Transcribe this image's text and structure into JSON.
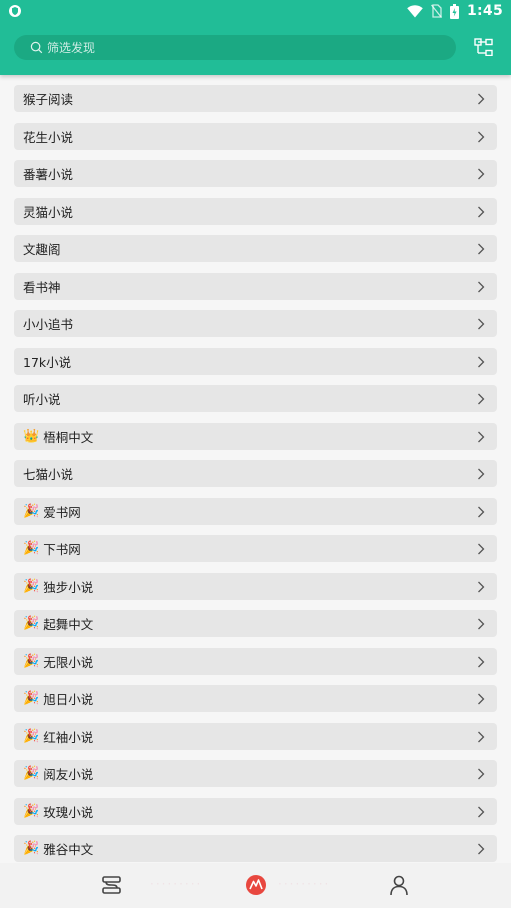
{
  "status_bar": {
    "time": "1:45",
    "icons": [
      "shield-icon",
      "wifi-icon",
      "no-sim-icon",
      "battery-icon"
    ]
  },
  "header": {
    "background_color": "#21bd97",
    "search_placeholder": "筛选发现",
    "search_icon": "search-icon",
    "menu_icon": "tree-menu-icon"
  },
  "sources": [
    {
      "label": "猴子阅读",
      "icon": ""
    },
    {
      "label": "花生小说",
      "icon": ""
    },
    {
      "label": "番薯小说",
      "icon": ""
    },
    {
      "label": "灵猫小说",
      "icon": ""
    },
    {
      "label": "文趣阁",
      "icon": ""
    },
    {
      "label": "看书神",
      "icon": ""
    },
    {
      "label": "小小追书",
      "icon": ""
    },
    {
      "label": "17k小说",
      "icon": ""
    },
    {
      "label": "听小说",
      "icon": ""
    },
    {
      "label": "梧桐中文",
      "icon": "👑"
    },
    {
      "label": "七猫小说",
      "icon": ""
    },
    {
      "label": "爱书网",
      "icon": "🎉"
    },
    {
      "label": "下书网",
      "icon": "🎉"
    },
    {
      "label": "独步小说",
      "icon": "🎉"
    },
    {
      "label": "起舞中文",
      "icon": "🎉"
    },
    {
      "label": "无限小说",
      "icon": "🎉"
    },
    {
      "label": "旭日小说",
      "icon": "🎉"
    },
    {
      "label": "红袖小说",
      "icon": "🎉"
    },
    {
      "label": "阅友小说",
      "icon": "🎉"
    },
    {
      "label": "玫瑰小说",
      "icon": "🎉"
    },
    {
      "label": "雅谷中文",
      "icon": "🎉"
    }
  ],
  "bottom_nav": {
    "items": [
      "bookshelf-icon",
      "discover-icon",
      "profile-icon"
    ],
    "accent_color": "#e8473f"
  }
}
